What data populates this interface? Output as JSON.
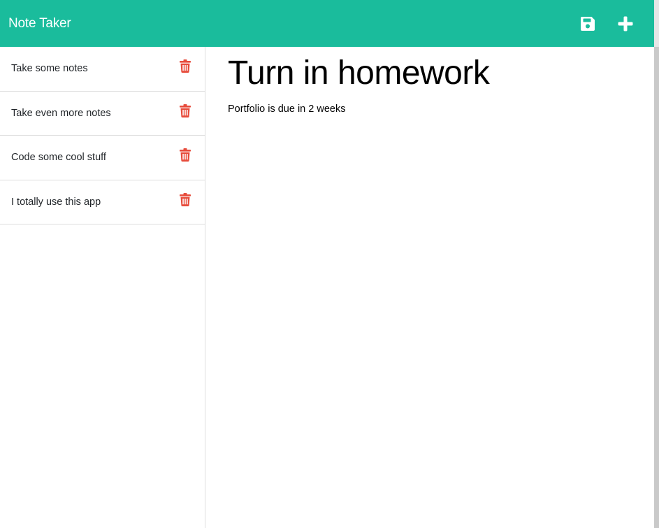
{
  "navbar": {
    "brand": "Note Taker",
    "save_icon": "save-icon",
    "new_icon": "plus-icon",
    "background": "#1abc9c"
  },
  "sidebar": {
    "notes": [
      {
        "title": "Take some notes",
        "delete_icon": "trash-icon"
      },
      {
        "title": "Take even more notes",
        "delete_icon": "trash-icon"
      },
      {
        "title": "Code some cool stuff",
        "delete_icon": "trash-icon"
      },
      {
        "title": "I totally use this app",
        "delete_icon": "trash-icon"
      }
    ],
    "delete_color": "#e74c3c"
  },
  "editor": {
    "title": "Turn in homework",
    "body": "Portfolio is due in 2 weeks"
  }
}
